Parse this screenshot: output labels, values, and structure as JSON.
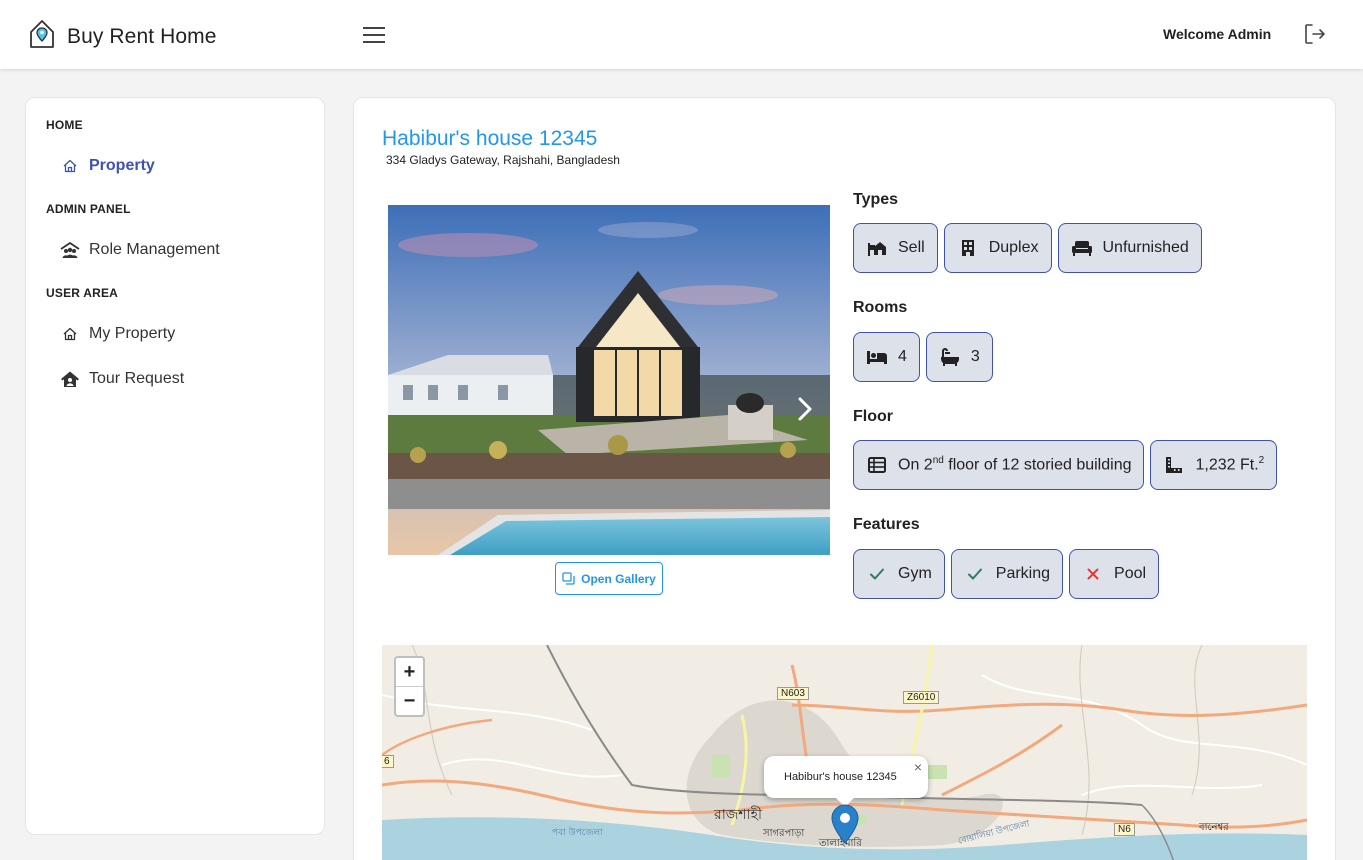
{
  "header": {
    "brand_title": "Buy Rent Home",
    "welcome": "Welcome Admin"
  },
  "sidebar": {
    "sections": [
      {
        "label": "HOME",
        "items": [
          {
            "label": "Property",
            "icon": "home-icon",
            "active": true
          }
        ]
      },
      {
        "label": "ADMIN PANEL",
        "items": [
          {
            "label": "Role Management",
            "icon": "users-roof-icon"
          }
        ]
      },
      {
        "label": "USER AREA",
        "items": [
          {
            "label": "My Property",
            "icon": "home-icon"
          },
          {
            "label": "Tour Request",
            "icon": "house-user-icon"
          }
        ]
      }
    ]
  },
  "property": {
    "title": "Habibur's house 12345",
    "address": "334 Gladys Gateway, Rajshahi, Bangladesh",
    "gallery_button": "Open Gallery",
    "types_label": "Types",
    "types": [
      "Sell",
      "Duplex",
      "Unfurnished"
    ],
    "rooms_label": "Rooms",
    "rooms": {
      "bedrooms": "4",
      "bathrooms": "3"
    },
    "floor_label": "Floor",
    "floor": {
      "prefix": "On 2",
      "sup": "nd",
      "suffix": " floor of 12 storied building"
    },
    "area": {
      "value": "1,232 Ft.",
      "sup": "2"
    },
    "features_label": "Features",
    "features": [
      {
        "label": "Gym",
        "available": true
      },
      {
        "label": "Parking",
        "available": true
      },
      {
        "label": "Pool",
        "available": false
      }
    ]
  },
  "map": {
    "zoom_in": "+",
    "zoom_out": "−",
    "popup_text": "Habibur's house 12345",
    "popup_close": "×",
    "labels": {
      "n603": "N603",
      "z6010": "Z6010",
      "n6": "N6",
      "six": "6",
      "rajshahi": "রাজশাহী",
      "sagorpara": "সাগরপাড়া",
      "talaimari": "তালাইমারি",
      "poba": "পবা উপজেলা",
      "boalia": "বোয়ালিয়া উপজেলা",
      "baneshwar": "বানেশ্বর"
    }
  },
  "colors": {
    "accent": "#2196f3",
    "active_nav": "#3f51b5",
    "chip_bg": "#dde1ea",
    "chip_border": "#3f51b5",
    "check": "#2e7d5b",
    "cross": "#e53935"
  }
}
